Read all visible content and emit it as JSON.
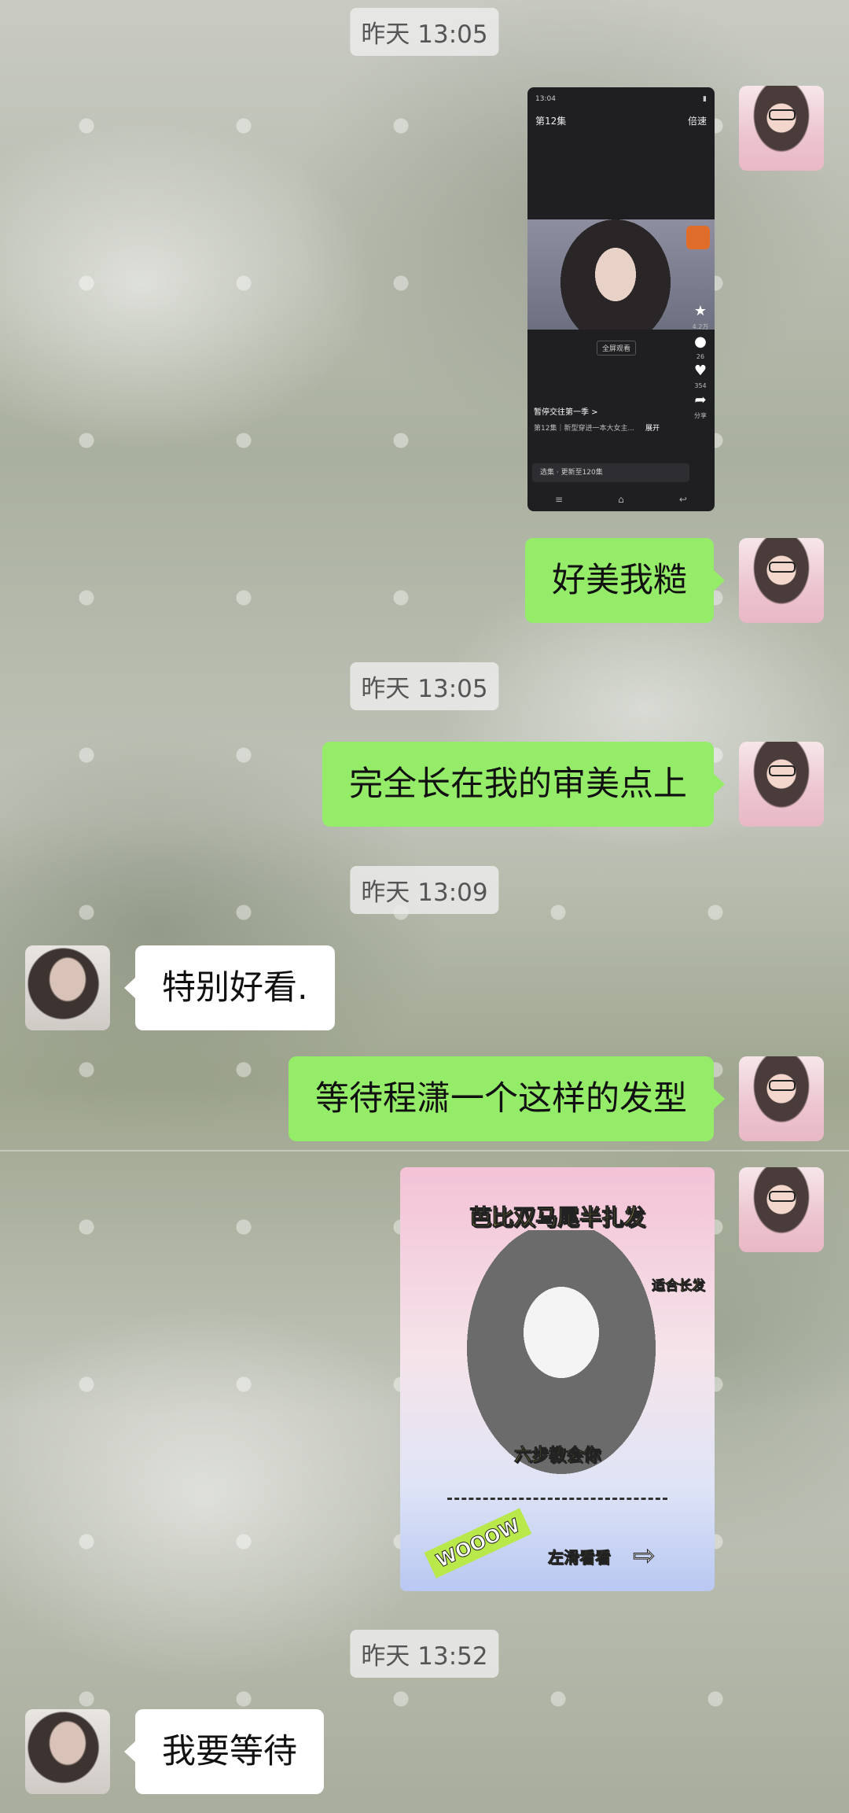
{
  "timestamps": [
    "昨天 13:05",
    "昨天 13:05",
    "昨天 13:09",
    "昨天 13:52"
  ],
  "messages": [
    {
      "from": "me",
      "text": "好美我糙"
    },
    {
      "from": "me",
      "text": "完全长在我的审美点上"
    },
    {
      "from": "other",
      "text": "特别好看."
    },
    {
      "from": "me",
      "text": "等待程潇一个这样的发型"
    },
    {
      "from": "other",
      "text": "我要等待"
    }
  ],
  "screenshot_image": {
    "status_time": "13:04",
    "episode": "第12集",
    "speed_label": "倍速",
    "fullscreen_label": "全屏观看",
    "show_title": "暂停交往第一季 >",
    "episode_desc": "第12集｜新型穿进一本大女主...",
    "expand_label": "展开",
    "select_label": "选集 · 更新至120集",
    "side_counts": [
      "4.2万",
      "26",
      "354",
      "分享"
    ]
  },
  "tutorial_card": {
    "title": "芭比双马尾半扎发",
    "suitable": "适合长发",
    "steps": "六步教会你",
    "wooow": "WOOOW",
    "swipe": "左滑看看"
  }
}
